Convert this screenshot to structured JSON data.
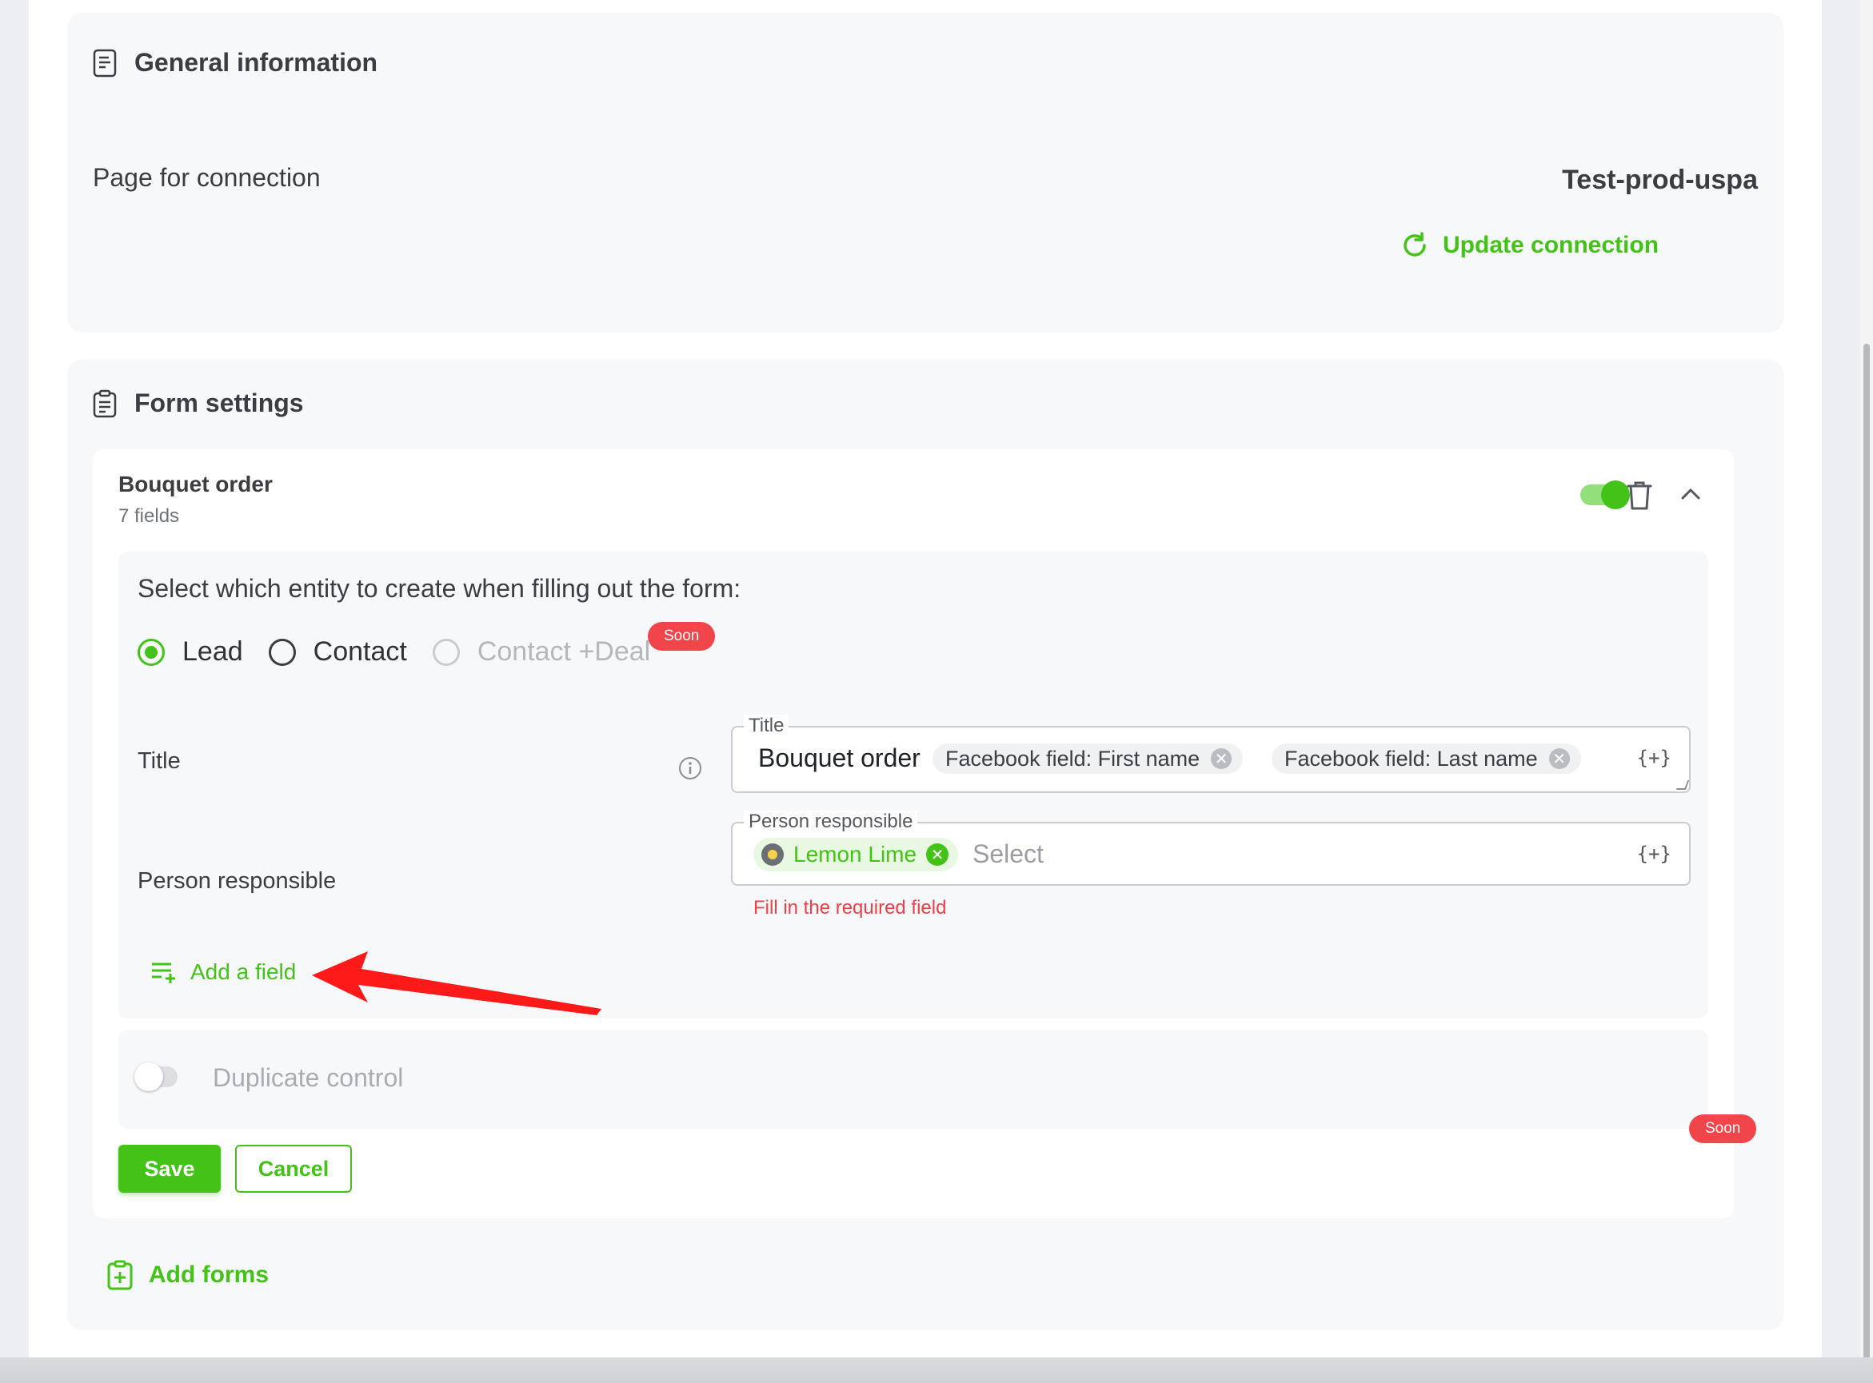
{
  "general": {
    "title": "General information",
    "page_label": "Page for connection",
    "page_name": "Test-prod-uspa",
    "update_button": "Update connection"
  },
  "form_settings": {
    "title": "Form settings",
    "form": {
      "name": "Bouquet order",
      "field_count": "7 fields",
      "enabled": true,
      "entity_question": "Select which entity to create when filling out the form:",
      "entity_options": [
        {
          "label": "Lead",
          "selected": true
        },
        {
          "label": "Contact",
          "selected": false
        },
        {
          "label": "Contact +Deal",
          "selected": false,
          "disabled": true
        }
      ],
      "soon_badge": "Soon",
      "title_field": {
        "label": "Title",
        "legend": "Title",
        "text": "Bouquet order",
        "chips": [
          "Facebook field: First name",
          "Facebook field: Last name"
        ],
        "var_button": "{+}"
      },
      "person_field": {
        "label": "Person responsible",
        "legend": "Person responsible",
        "chip": "Lemon Lime",
        "placeholder": "Select",
        "var_button": "{+}",
        "error": "Fill in the required field"
      },
      "add_field": "Add a field",
      "duplicate_control": "Duplicate control",
      "duplicate_soon": "Soon",
      "save": "Save",
      "cancel": "Cancel"
    },
    "add_forms": "Add forms"
  },
  "colors": {
    "accent": "#43c317",
    "error": "#ef3e46",
    "soon_badge": "#f2444b",
    "annotation_arrow": "#ff1a1a"
  },
  "icons": [
    "document-icon",
    "clipboard-icon",
    "refresh-icon",
    "trash-icon",
    "chevron-up-icon",
    "info-icon",
    "add-list-icon",
    "clipboard-plus-icon"
  ]
}
